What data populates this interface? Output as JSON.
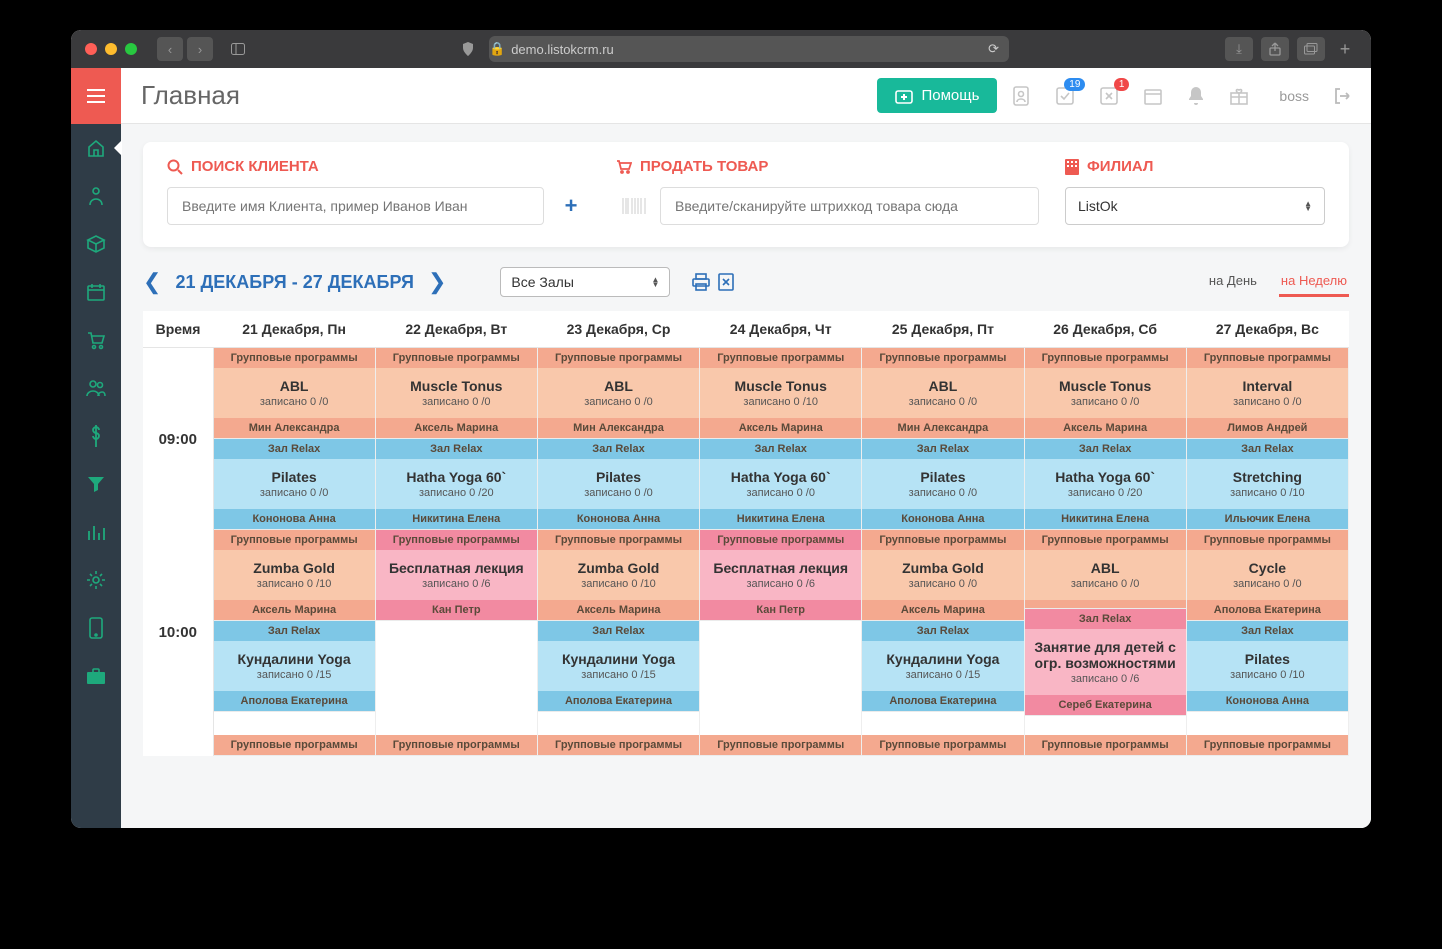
{
  "browser": {
    "url": "demo.listokcrm.ru"
  },
  "top": {
    "title": "Главная",
    "help": "Помощь",
    "badge1": "19",
    "badge2": "1",
    "user": "boss"
  },
  "search": {
    "client_label": "ПОИСК КЛИЕНТА",
    "client_placeholder": "Введите имя Клиента, пример Иванов Иван",
    "sell_label": "ПРОДАТЬ ТОВАР",
    "sell_placeholder": "Введите/сканируйте штрихкод товара сюда",
    "branch_label": "ФИЛИАЛ",
    "branch_value": "ListOk"
  },
  "date": {
    "range": "21 ДЕКАБРЯ - 27 ДЕКАБРЯ",
    "hall": "Все Залы",
    "view_day": "на День",
    "view_week": "на Неделю"
  },
  "days": [
    "Время",
    "21 Декабря, Пн",
    "22 Декабря, Вт",
    "23 Декабря, Ср",
    "24 Декабря, Чт",
    "25 Декабря, Пт",
    "26 Декабря, Сб",
    "27 Декабря, Вс"
  ],
  "rows": [
    {
      "time": "09:00",
      "cells": [
        [
          {
            "color": "orange",
            "head": "Групповые программы",
            "title": "ABL",
            "sub": "записано 0 /0",
            "foot": "Мин Александра"
          },
          {
            "color": "blue",
            "head": "Зал Relax",
            "title": "Pilates",
            "sub": "записано 0 /0",
            "foot": "Кононова Анна"
          }
        ],
        [
          {
            "color": "orange",
            "head": "Групповые программы",
            "title": "Muscle Tonus",
            "sub": "записано 0 /0",
            "foot": "Аксель Марина"
          },
          {
            "color": "blue",
            "head": "Зал Relax",
            "title": "Hatha Yoga 60`",
            "sub": "записано 0 /20",
            "foot": "Никитина Елена"
          }
        ],
        [
          {
            "color": "orange",
            "head": "Групповые программы",
            "title": "ABL",
            "sub": "записано 0 /0",
            "foot": "Мин Александра"
          },
          {
            "color": "blue",
            "head": "Зал Relax",
            "title": "Pilates",
            "sub": "записано 0 /0",
            "foot": "Кононова Анна"
          }
        ],
        [
          {
            "color": "orange",
            "head": "Групповые программы",
            "title": "Muscle Tonus",
            "sub": "записано 0 /10",
            "foot": "Аксель Марина"
          },
          {
            "color": "blue",
            "head": "Зал Relax",
            "title": "Hatha Yoga 60`",
            "sub": "записано 0 /0",
            "foot": "Никитина Елена"
          }
        ],
        [
          {
            "color": "orange",
            "head": "Групповые программы",
            "title": "ABL",
            "sub": "записано 0 /0",
            "foot": "Мин Александра"
          },
          {
            "color": "blue",
            "head": "Зал Relax",
            "title": "Pilates",
            "sub": "записано 0 /0",
            "foot": "Кононова Анна"
          }
        ],
        [
          {
            "color": "orange",
            "head": "Групповые программы",
            "title": "Muscle Tonus",
            "sub": "записано 0 /0",
            "foot": "Аксель Марина"
          },
          {
            "color": "blue",
            "head": "Зал Relax",
            "title": "Hatha Yoga 60`",
            "sub": "записано 0 /20",
            "foot": "Никитина Елена"
          }
        ],
        [
          {
            "color": "orange",
            "head": "Групповые программы",
            "title": "Interval",
            "sub": "записано 0 /0",
            "foot": "Лимов Андрей"
          },
          {
            "color": "blue",
            "head": "Зал Relax",
            "title": "Stretching",
            "sub": "записано 0 /10",
            "foot": "Ильючик Елена"
          }
        ]
      ]
    },
    {
      "time": "10:00",
      "cells": [
        [
          {
            "color": "orange",
            "head": "Групповые программы",
            "title": "Zumba Gold",
            "sub": "записано 0 /10",
            "foot": "Аксель Марина"
          },
          {
            "color": "blue",
            "head": "Зал Relax",
            "title": "Кундалини Yoga",
            "sub": "записано 0 /15",
            "foot": "Аполова Екатерина"
          }
        ],
        [
          {
            "color": "pink",
            "head": "Групповые программы",
            "title": "Бесплатная лекция",
            "sub": "записано 0 /6",
            "foot": "Кан Петр"
          },
          {
            "empty": true
          }
        ],
        [
          {
            "color": "orange",
            "head": "Групповые программы",
            "title": "Zumba Gold",
            "sub": "записано 0 /10",
            "foot": "Аксель Марина"
          },
          {
            "color": "blue",
            "head": "Зал Relax",
            "title": "Кундалини Yoga",
            "sub": "записано 0 /15",
            "foot": "Аполова Екатерина"
          }
        ],
        [
          {
            "color": "pink",
            "head": "Групповые программы",
            "title": "Бесплатная лекция",
            "sub": "записано 0 /6",
            "foot": "Кан Петр"
          },
          {
            "empty": true
          }
        ],
        [
          {
            "color": "orange",
            "head": "Групповые программы",
            "title": "Zumba Gold",
            "sub": "записано 0 /0",
            "foot": "Аксель Марина"
          },
          {
            "color": "blue",
            "head": "Зал Relax",
            "title": "Кундалини Yoga",
            "sub": "записано 0 /15",
            "foot": "Аполова Екатерина"
          }
        ],
        [
          {
            "color": "orange",
            "head": "Групповые программы",
            "title": "ABL",
            "sub": "записано 0 /0",
            "foot": ""
          },
          {
            "color": "pink",
            "head": "Зал Relax",
            "title": "Занятие для детей с огр. возможностями",
            "sub": "записано 0 /6",
            "foot": "Сереб Екатерина"
          }
        ],
        [
          {
            "color": "orange",
            "head": "Групповые программы",
            "title": "Cycle",
            "sub": "записано 0 /0",
            "foot": "Аполова Екатерина"
          },
          {
            "color": "blue",
            "head": "Зал Relax",
            "title": "Pilates",
            "sub": "записано 0 /10",
            "foot": "Кононова Анна"
          }
        ]
      ]
    },
    {
      "time": "",
      "cells": [
        [
          {
            "color": "orange",
            "head": "Групповые программы"
          }
        ],
        [
          {
            "color": "orange",
            "head": "Групповые программы"
          }
        ],
        [
          {
            "color": "orange",
            "head": "Групповые программы"
          }
        ],
        [
          {
            "color": "orange",
            "head": "Групповые программы"
          }
        ],
        [
          {
            "color": "orange",
            "head": "Групповые программы"
          }
        ],
        [
          {
            "color": "orange",
            "head": "Групповые программы"
          }
        ],
        [
          {
            "color": "orange",
            "head": "Групповые программы"
          }
        ]
      ]
    }
  ]
}
